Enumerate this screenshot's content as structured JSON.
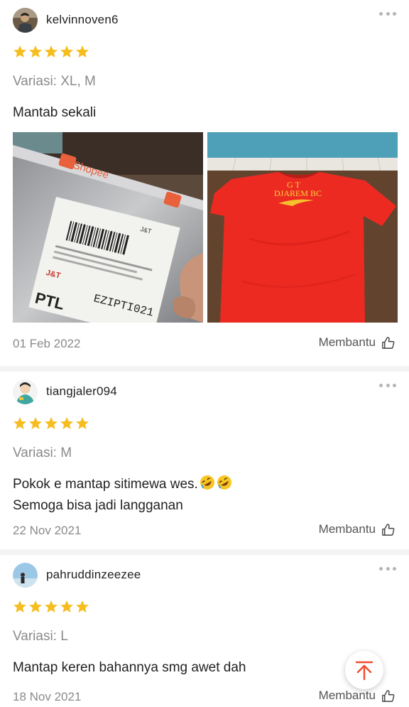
{
  "reviews": [
    {
      "username": "kelvinnoven6",
      "rating": 5,
      "variant": "Variasi: XL, M",
      "comment_lines": [
        "Mantab sekali"
      ],
      "photos": [
        "package-photo",
        "red-jersey-photo"
      ],
      "photo_texts": {
        "package_brand": "Shopee",
        "courier": "J&T",
        "code": "EZIPTI021",
        "code_prefix": "PTL",
        "jersey_text": "G T",
        "jersey_text2": "DJAREM BC"
      },
      "date": "01 Feb 2022",
      "helpful_label": "Membantu"
    },
    {
      "username": "tiangjaler094",
      "rating": 5,
      "variant": "Variasi: M",
      "comment_lines": [
        "Pokok e mantap sitimewa wes.",
        "Semoga bisa jadi langganan"
      ],
      "emoji": "rolling-on-floor-laughing",
      "date": "22 Nov 2021",
      "helpful_label": "Membantu"
    },
    {
      "username": "pahruddinzeezee",
      "rating": 5,
      "variant": "Variasi: L",
      "comment_lines": [
        "Mantap keren bahannya smg awet dah"
      ],
      "date": "18 Nov 2021",
      "helpful_label": "Membantu"
    }
  ],
  "colors": {
    "star": "#f6bd1f",
    "accent": "#ee4d2d",
    "muted": "#8a8a8a"
  },
  "icons": {
    "more": "more-dots-icon",
    "helpful": "thumbs-up-icon",
    "scroll_top": "arrow-to-top-icon"
  }
}
